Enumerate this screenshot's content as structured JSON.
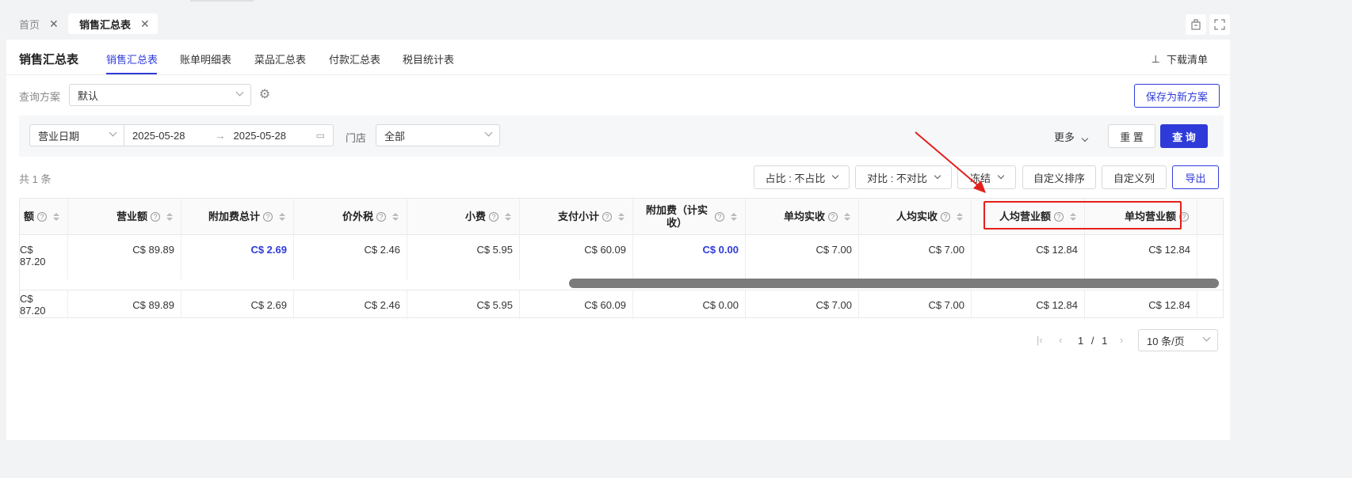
{
  "page_tabs": [
    {
      "label": "首页",
      "active": false
    },
    {
      "label": "销售汇总表",
      "active": true
    }
  ],
  "window_icons": [
    "building-icon",
    "fullscreen-icon"
  ],
  "report": {
    "title": "销售汇总表",
    "tabs": [
      "销售汇总表",
      "账单明细表",
      "菜品汇总表",
      "付款汇总表",
      "税目统计表"
    ],
    "active_tab": "销售汇总表",
    "download_label": "下载清单"
  },
  "scheme": {
    "label": "查询方案",
    "value": "默认",
    "save_label": "保存为新方案"
  },
  "filter": {
    "date_type": "营业日期",
    "start_date": "2025-05-28",
    "end_date": "2025-05-28",
    "date_sep": "→",
    "store_label": "门店",
    "store_value": "全部",
    "more_label": "更多",
    "reset_label": "重 置",
    "query_label": "查 询"
  },
  "toolbar": {
    "count_text": "共 1 条",
    "ratio_label": "占比 : 不占比",
    "compare_label": "对比 : 不对比",
    "freeze_label": "冻结",
    "custom_sort_label": "自定义排序",
    "custom_cols_label": "自定义列",
    "export_label": "导出"
  },
  "table": {
    "columns": [
      "额",
      "营业额",
      "附加费总计",
      "价外税",
      "小费",
      "支付小计",
      "附加费（计实收）",
      "单均实收",
      "人均实收",
      "人均营业额",
      "单均营业额"
    ],
    "row": [
      "C$ 87.20",
      "C$ 89.89",
      "C$ 2.69",
      "C$ 2.46",
      "C$ 5.95",
      "C$ 60.09",
      "C$ 0.00",
      "C$ 7.00",
      "C$ 7.00",
      "C$ 12.84",
      "C$ 12.84"
    ],
    "link_columns": [
      2,
      6
    ],
    "total_row": [
      "C$ 87.20",
      "C$ 89.89",
      "C$ 2.69",
      "C$ 2.46",
      "C$ 5.95",
      "C$ 60.09",
      "C$ 0.00",
      "C$ 7.00",
      "C$ 7.00",
      "C$ 12.84",
      "C$ 12.84"
    ],
    "highlighted_columns": [
      "人均营业额",
      "单均营业额"
    ]
  },
  "pagination": {
    "current": "1",
    "separator": "/",
    "total": "1",
    "page_size": "10 条/页"
  },
  "colors": {
    "primary": "#2f3bd8",
    "annotation": "#e3201b"
  }
}
